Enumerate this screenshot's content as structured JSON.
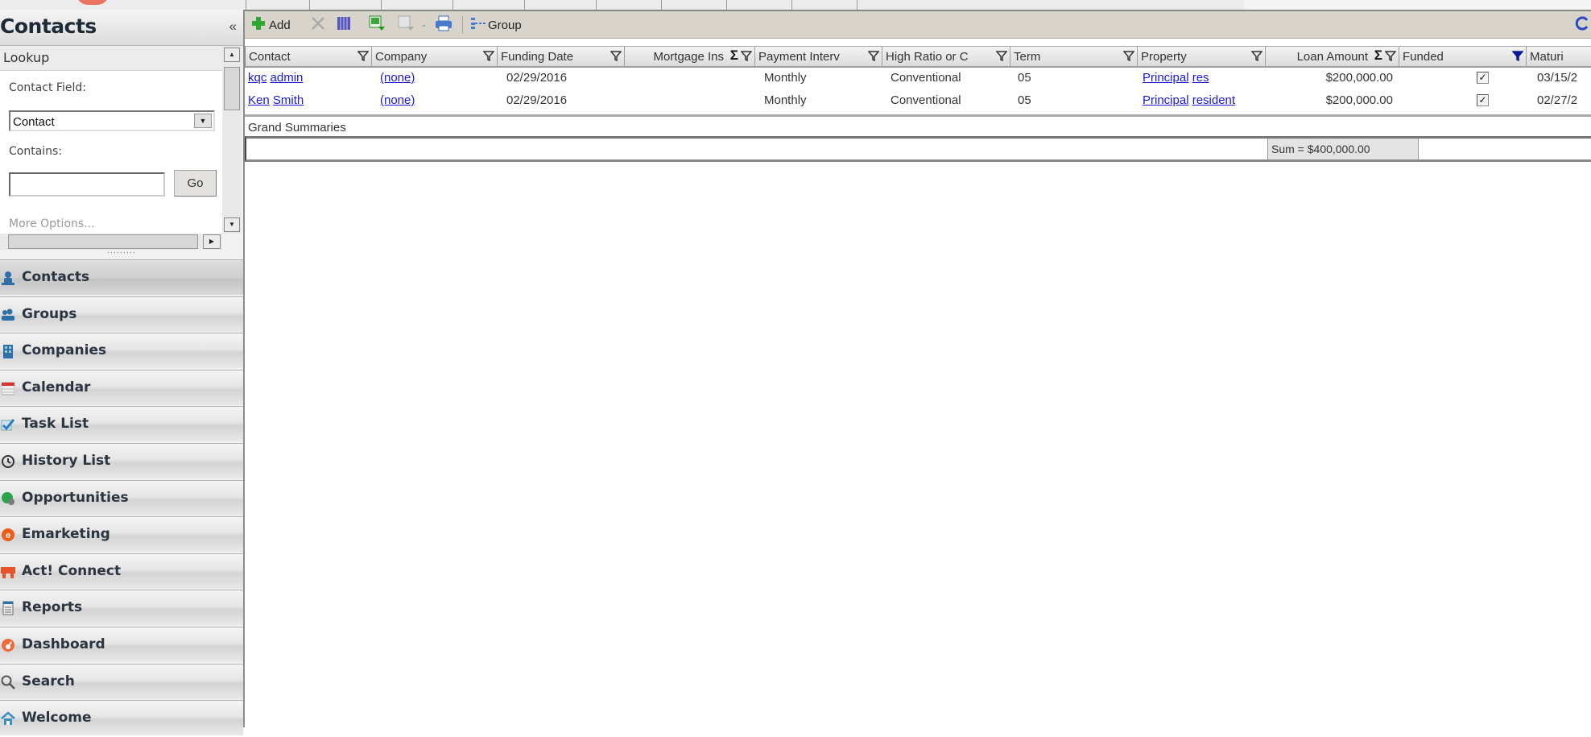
{
  "app": {
    "top_tabs": [
      "",
      "",
      "",
      "",
      "",
      "",
      "",
      "",
      "",
      "",
      ""
    ]
  },
  "sidebar": {
    "title": "Contacts",
    "collapse_label": "«",
    "lookup": {
      "title": "Lookup",
      "contact_field_label": "Contact Field:",
      "contact_field_value": "Contact",
      "contains_label": "Contains:",
      "contains_value": "",
      "go_label": "Go",
      "more_options_label": "More Options..."
    },
    "nav_items": [
      {
        "label": "Contacts",
        "icon": "contact-person-icon",
        "active": true
      },
      {
        "label": "Groups",
        "icon": "group-people-icon"
      },
      {
        "label": "Companies",
        "icon": "building-icon"
      },
      {
        "label": "Calendar",
        "icon": "calendar-icon"
      },
      {
        "label": "Task List",
        "icon": "checkmark-icon"
      },
      {
        "label": "History List",
        "icon": "history-clock-icon"
      },
      {
        "label": "Opportunities",
        "icon": "opportunities-icon"
      },
      {
        "label": "Emarketing",
        "icon": "emarketing-e-icon"
      },
      {
        "label": "Act! Connect",
        "icon": "cart-icon"
      },
      {
        "label": "Reports",
        "icon": "report-document-icon"
      },
      {
        "label": "Dashboard",
        "icon": "dashboard-gauge-icon"
      },
      {
        "label": "Search",
        "icon": "magnifier-icon"
      },
      {
        "label": "Welcome",
        "icon": "home-icon"
      }
    ]
  },
  "toolbar": {
    "add_label": "Add",
    "group_label": "Group",
    "icons": [
      "add-icon",
      "delete-icon",
      "columns-icon",
      "export-excel-icon",
      "edit-icon",
      "dropdown-icon",
      "print-icon",
      "group-icon",
      "refresh-icon"
    ]
  },
  "grid": {
    "columns": [
      {
        "label": "Contact",
        "sum": false,
        "filter_active": false
      },
      {
        "label": "Company",
        "sum": false,
        "filter_active": false
      },
      {
        "label": "Funding Date",
        "sum": false,
        "filter_active": false
      },
      {
        "label": "Mortgage Ins",
        "sum": true,
        "filter_active": false
      },
      {
        "label": "Payment Interv",
        "sum": false,
        "filter_active": false
      },
      {
        "label": "High Ratio or C",
        "sum": false,
        "filter_active": false
      },
      {
        "label": "Term",
        "sum": false,
        "filter_active": false
      },
      {
        "label": "Property",
        "sum": false,
        "filter_active": false
      },
      {
        "label": "Loan Amount",
        "sum": true,
        "filter_active": false
      },
      {
        "label": "Funded",
        "sum": false,
        "filter_active": true
      },
      {
        "label": "Maturi",
        "sum": false,
        "filter_active": false
      }
    ],
    "rows": [
      {
        "contact_first": "kqc",
        "contact_last": "admin",
        "company": "(none)",
        "funding_date": "02/29/2016",
        "mortgage_ins": "",
        "payment_interval": "Monthly",
        "high_ratio": "Conventional",
        "term": "05",
        "property_a": "Principal",
        "property_b": "res",
        "loan_amount": "$200,000.00",
        "funded": true,
        "maturity": "03/15/2"
      },
      {
        "contact_first": "Ken",
        "contact_last": "Smith",
        "company": "(none)",
        "funding_date": "02/29/2016",
        "mortgage_ins": "",
        "payment_interval": "Monthly",
        "high_ratio": "Conventional",
        "term": "05",
        "property_a": "Principal",
        "property_b": "resident",
        "loan_amount": "$200,000.00",
        "funded": true,
        "maturity": "02/27/2"
      }
    ],
    "grand_summaries_label": "Grand Summaries",
    "loan_amount_sum": "Sum = $400,000.00"
  },
  "colors": {
    "link": "#1a1ad8",
    "active_filter": "#0a1a9a",
    "toolbar_bg": "#d8d4cc"
  }
}
